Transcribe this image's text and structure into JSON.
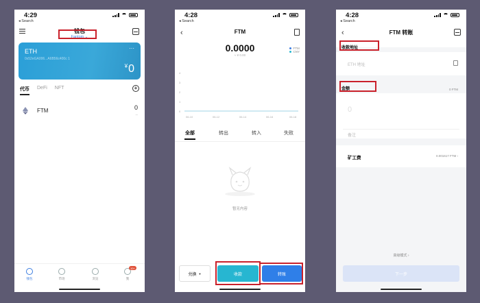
{
  "status": {
    "time_1": "4:29",
    "time_2": "4:28",
    "time_3": "4:28",
    "back_app": "◂ Search"
  },
  "screen1": {
    "title": "钱包",
    "wallet_name": "Fantom",
    "wallet_caret": "⌄",
    "card": {
      "chain": "ETH",
      "address": "0x52eGA006...A6B56c400c 1",
      "more": "···",
      "currency": "¥",
      "balance": "0"
    },
    "tabs": [
      "代币",
      "DeFi",
      "NFT"
    ],
    "add_icon": "+",
    "token": {
      "name": "FTM",
      "amount": "0",
      "amount_sub": "--"
    },
    "nav": [
      "钱包",
      "市场",
      "浏览",
      "我"
    ],
    "nav_badge": "10+",
    "colors": {
      "card": "#2b9fd8",
      "accent": "#3b7de0",
      "highlight": "#c9202a"
    }
  },
  "screen2": {
    "back": "‹",
    "title": "FTM",
    "balance": "0.0000",
    "balance_sub": "≈ ¥ 0.00",
    "legend": [
      "FTM",
      "CNY"
    ],
    "y_ticks": [
      "4",
      "3",
      "2",
      "1",
      "0"
    ],
    "x_ticks": [
      "06-10",
      "06-12",
      "06-14",
      "06-16",
      "06-18"
    ],
    "tabs": [
      "全部",
      "转出",
      "转入",
      "失败"
    ],
    "empty_text": "暂无内容",
    "swap_label": "兑换",
    "swap_caret": "▼",
    "receive_label": "收款",
    "transfer_label": "转账",
    "colors": {
      "receive": "#27b6d1",
      "transfer": "#2f7fe8"
    }
  },
  "screen3": {
    "back": "‹",
    "title": "FTM 转账",
    "recipient_label": "收款地址",
    "recipient_placeholder": "ETH 地址",
    "amount_label": "金额",
    "amount_balance": "0 FTM",
    "amount_placeholder": "0",
    "memo_placeholder": "备注",
    "fee_label": "矿工费",
    "fee_value": "0.001617 FTM  ›",
    "advanced_label": "高级模式  ›",
    "next_label": "下一步"
  }
}
